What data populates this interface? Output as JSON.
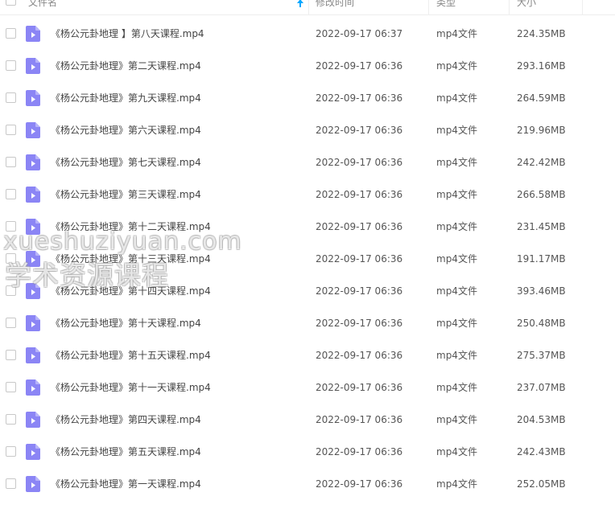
{
  "header": {
    "name": "文件名",
    "modified": "修改时间",
    "type": "类型",
    "size": "大小"
  },
  "colors": {
    "accent": "#06a7ff",
    "file_icon": "#8b85f5"
  },
  "icons": {
    "sort": "sort-up-arrow-icon",
    "file": "video-file-icon"
  },
  "files": [
    {
      "name": "《杨公元卦地理 】第八天课程.mp4",
      "modified": "2022-09-17 06:37",
      "type": "mp4文件",
      "size": "224.35MB"
    },
    {
      "name": "《杨公元卦地理》第二天课程.mp4",
      "modified": "2022-09-17 06:36",
      "type": "mp4文件",
      "size": "293.16MB"
    },
    {
      "name": "《杨公元卦地理》第九天课程.mp4",
      "modified": "2022-09-17 06:36",
      "type": "mp4文件",
      "size": "264.59MB"
    },
    {
      "name": "《杨公元卦地理》第六天课程.mp4",
      "modified": "2022-09-17 06:36",
      "type": "mp4文件",
      "size": "219.96MB"
    },
    {
      "name": "《杨公元卦地理》第七天课程.mp4",
      "modified": "2022-09-17 06:36",
      "type": "mp4文件",
      "size": "242.42MB"
    },
    {
      "name": "《杨公元卦地理》第三天课程.mp4",
      "modified": "2022-09-17 06:36",
      "type": "mp4文件",
      "size": "266.58MB"
    },
    {
      "name": "《杨公元卦地理》第十二天课程.mp4",
      "modified": "2022-09-17 06:36",
      "type": "mp4文件",
      "size": "231.45MB"
    },
    {
      "name": "《杨公元卦地理》第十三天课程.mp4",
      "modified": "2022-09-17 06:36",
      "type": "mp4文件",
      "size": "191.17MB"
    },
    {
      "name": "《杨公元卦地理》第十四天课程.mp4",
      "modified": "2022-09-17 06:36",
      "type": "mp4文件",
      "size": "393.46MB"
    },
    {
      "name": "《杨公元卦地理》第十天课程.mp4",
      "modified": "2022-09-17 06:36",
      "type": "mp4文件",
      "size": "250.48MB"
    },
    {
      "name": "《杨公元卦地理》第十五天课程.mp4",
      "modified": "2022-09-17 06:36",
      "type": "mp4文件",
      "size": "275.37MB"
    },
    {
      "name": "《杨公元卦地理》第十一天课程.mp4",
      "modified": "2022-09-17 06:36",
      "type": "mp4文件",
      "size": "237.07MB"
    },
    {
      "name": "《杨公元卦地理》第四天课程.mp4",
      "modified": "2022-09-17 06:36",
      "type": "mp4文件",
      "size": "204.53MB"
    },
    {
      "name": "《杨公元卦地理》第五天课程.mp4",
      "modified": "2022-09-17 06:36",
      "type": "mp4文件",
      "size": "242.43MB"
    },
    {
      "name": "《杨公元卦地理》第一天课程.mp4",
      "modified": "2022-09-17 06:36",
      "type": "mp4文件",
      "size": "252.05MB"
    }
  ],
  "watermark": {
    "line1": "xueshuziyuan.com",
    "line2": "学术资源课程"
  }
}
